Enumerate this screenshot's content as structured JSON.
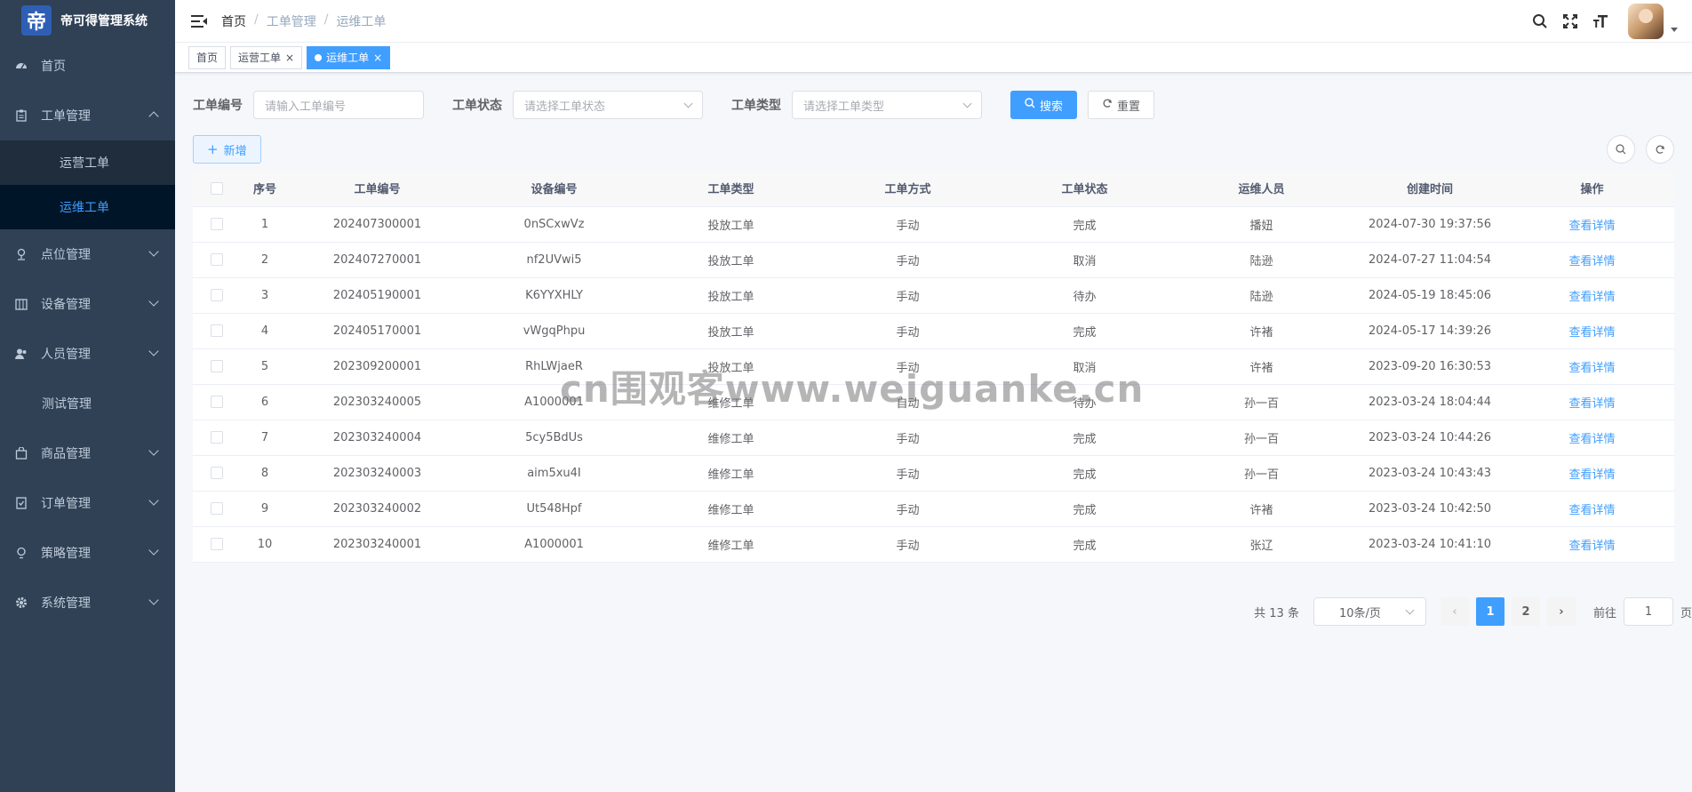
{
  "app": {
    "title": "帝可得管理系统",
    "logo_glyph": "帝"
  },
  "sidebar": {
    "items": [
      {
        "label": "首页",
        "icon": "dashboard-icon"
      },
      {
        "label": "工单管理",
        "icon": "clipboard-icon",
        "expanded": true,
        "children": [
          "运营工单",
          "运维工单"
        ]
      },
      {
        "label": "点位管理",
        "icon": "location-icon"
      },
      {
        "label": "设备管理",
        "icon": "device-icon"
      },
      {
        "label": "人员管理",
        "icon": "users-icon"
      },
      {
        "label": "测试管理"
      },
      {
        "label": "商品管理",
        "icon": "shopping-icon"
      },
      {
        "label": "订单管理",
        "icon": "order-icon"
      },
      {
        "label": "策略管理",
        "icon": "bulb-icon"
      },
      {
        "label": "系统管理",
        "icon": "gear-icon"
      }
    ],
    "active": "运维工单"
  },
  "breadcrumb": [
    "首页",
    "工单管理",
    "运维工单"
  ],
  "tags": [
    {
      "label": "首页"
    },
    {
      "label": "运营工单",
      "closable": true
    },
    {
      "label": "运维工单",
      "closable": true,
      "active": true
    }
  ],
  "search": {
    "order_no_label": "工单编号",
    "order_no_placeholder": "请输入工单编号",
    "status_label": "工单状态",
    "status_placeholder": "请选择工单状态",
    "type_label": "工单类型",
    "type_placeholder": "请选择工单类型",
    "search_button": "搜索",
    "reset_button": "重置"
  },
  "toolbar": {
    "add_button": "新增"
  },
  "table": {
    "columns": [
      "序号",
      "工单编号",
      "设备编号",
      "工单类型",
      "工单方式",
      "工单状态",
      "运维人员",
      "创建时间",
      "操作"
    ],
    "rows": [
      [
        "1",
        "202407300001",
        "0nSCxwVz",
        "投放工单",
        "手动",
        "完成",
        "播妞",
        "2024-07-30 19:37:56",
        "查看详情"
      ],
      [
        "2",
        "202407270001",
        "nf2UVwi5",
        "投放工单",
        "手动",
        "取消",
        "陆逊",
        "2024-07-27 11:04:54",
        "查看详情"
      ],
      [
        "3",
        "202405190001",
        "K6YYXHLY",
        "投放工单",
        "手动",
        "待办",
        "陆逊",
        "2024-05-19 18:45:06",
        "查看详情"
      ],
      [
        "4",
        "202405170001",
        "vWgqPhpu",
        "投放工单",
        "手动",
        "完成",
        "许褚",
        "2024-05-17 14:39:26",
        "查看详情"
      ],
      [
        "5",
        "202309200001",
        "RhLWjaeR",
        "投放工单",
        "手动",
        "取消",
        "许褚",
        "2023-09-20 16:30:53",
        "查看详情"
      ],
      [
        "6",
        "202303240005",
        "A1000001",
        "维修工单",
        "自动",
        "待办",
        "孙一百",
        "2023-03-24 18:04:44",
        "查看详情"
      ],
      [
        "7",
        "202303240004",
        "5cy5BdUs",
        "维修工单",
        "手动",
        "完成",
        "孙一百",
        "2023-03-24 10:44:26",
        "查看详情"
      ],
      [
        "8",
        "202303240003",
        "aim5xu4I",
        "维修工单",
        "手动",
        "完成",
        "孙一百",
        "2023-03-24 10:43:43",
        "查看详情"
      ],
      [
        "9",
        "202303240002",
        "Ut548Hpf",
        "维修工单",
        "手动",
        "完成",
        "许褚",
        "2023-03-24 10:42:50",
        "查看详情"
      ],
      [
        "10",
        "202303240001",
        "A1000001",
        "维修工单",
        "手动",
        "完成",
        "张辽",
        "2023-03-24 10:41:10",
        "查看详情"
      ]
    ]
  },
  "pagination": {
    "total_text": "共 13 条",
    "page_size": "10条/页",
    "pages": [
      "1",
      "2"
    ],
    "current": "1",
    "goto_label": "前往",
    "goto_value": "1",
    "page_suffix": "页"
  },
  "watermark": "cn围观客www.weiguanke.cn",
  "colors": {
    "primary": "#409eff",
    "sidebar_bg": "#304156",
    "submenu_bg": "#1f2d3d",
    "active_bg": "#001528"
  }
}
